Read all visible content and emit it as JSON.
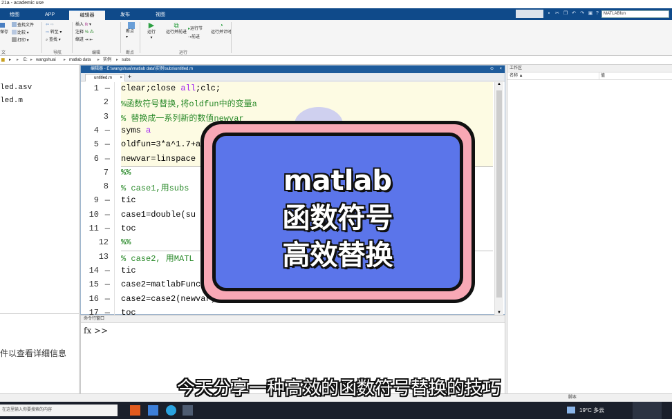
{
  "window": {
    "title": "21a - academic use"
  },
  "tabs": [
    {
      "label": "绘图"
    },
    {
      "label": "APP"
    },
    {
      "label": "编辑器"
    },
    {
      "label": "发布"
    },
    {
      "label": "视图"
    }
  ],
  "search": {
    "value": "MATLABfun"
  },
  "ribbon": {
    "file_group": {
      "save_label": "保存",
      "find_files": "查找文件",
      "compare": "比较",
      "print": "打印",
      "label": "文件"
    },
    "nav_group": {
      "goto": "转至",
      "find": "查找",
      "label": "导航"
    },
    "edit_group": {
      "insert": "插入",
      "comment": "注释",
      "indent": "缩进",
      "fx": "fx",
      "label": "编辑"
    },
    "breakpoint_group": {
      "breakpoints": "断点",
      "label": "断点"
    },
    "run_group": {
      "run": "运行",
      "run_advance": "运行并前进",
      "run_section": "运行节",
      "advance": "前进",
      "run_time": "运行并计时",
      "label": "运行"
    }
  },
  "address": {
    "path": [
      "E:",
      "wangshuai",
      "matlab data",
      "实例",
      "subs"
    ]
  },
  "left_panel": {
    "files": [
      "led.asv",
      "led.m"
    ],
    "detail_text": "件以查看详细信息"
  },
  "editor": {
    "header": "编辑器 - E:\\wangshuai\\matlab data\\实例\\subs\\untitled.m",
    "tab_label": "untitled.m",
    "lines": [
      {
        "num": "1",
        "dash": "—",
        "text": "clear;close all;clc;",
        "style": "code"
      },
      {
        "num": "2",
        "dash": "",
        "text": "%函数符号替换,将oldfun中的变量a",
        "style": "cm"
      },
      {
        "num": "3",
        "dash": "",
        "text": "% 替换成一系列新的数值newvar",
        "style": "cm"
      },
      {
        "num": "4",
        "dash": "—",
        "text": "syms a",
        "style": "code"
      },
      {
        "num": "5",
        "dash": "—",
        "text": "oldfun=3*a^1.7+a",
        "style": "code"
      },
      {
        "num": "6",
        "dash": "—",
        "text": "newvar=linspace",
        "style": "code"
      },
      {
        "num": "7",
        "dash": "",
        "text": "%%",
        "style": "cell"
      },
      {
        "num": "8",
        "dash": "",
        "text": "% case1,用subs",
        "style": "cm"
      },
      {
        "num": "9",
        "dash": "—",
        "text": "tic",
        "style": "code"
      },
      {
        "num": "10",
        "dash": "—",
        "text": "case1=double(su",
        "style": "code"
      },
      {
        "num": "11",
        "dash": "—",
        "text": "toc",
        "style": "code"
      },
      {
        "num": "12",
        "dash": "",
        "text": "%%",
        "style": "cell"
      },
      {
        "num": "13",
        "dash": "",
        "text": "% case2, 用MATL",
        "style": "cm"
      },
      {
        "num": "14",
        "dash": "—",
        "text": "tic",
        "style": "code"
      },
      {
        "num": "15",
        "dash": "—",
        "text": "case2=matlabFunc",
        "style": "code"
      },
      {
        "num": "16",
        "dash": "—",
        "text": "case2=case2(newvar);",
        "style": "code"
      },
      {
        "num": "17",
        "dash": "—",
        "text": "toc",
        "style": "code"
      }
    ]
  },
  "command_window": {
    "header": "命令行窗口",
    "prompt": "fx >>"
  },
  "workspace": {
    "header": "工作区",
    "col_name": "名称 ▲",
    "col_value": "值"
  },
  "status": {
    "left": "",
    "right": "脚本"
  },
  "taskbar": {
    "search_placeholder": "在这里输入你要搜索的内容",
    "weather": "19°C 多云"
  },
  "overlay": {
    "line1": "matlab",
    "line2": "函数符号",
    "line3": "高效替换"
  },
  "subtitle": "今天分享一种高效的函数符号替换的技巧"
}
